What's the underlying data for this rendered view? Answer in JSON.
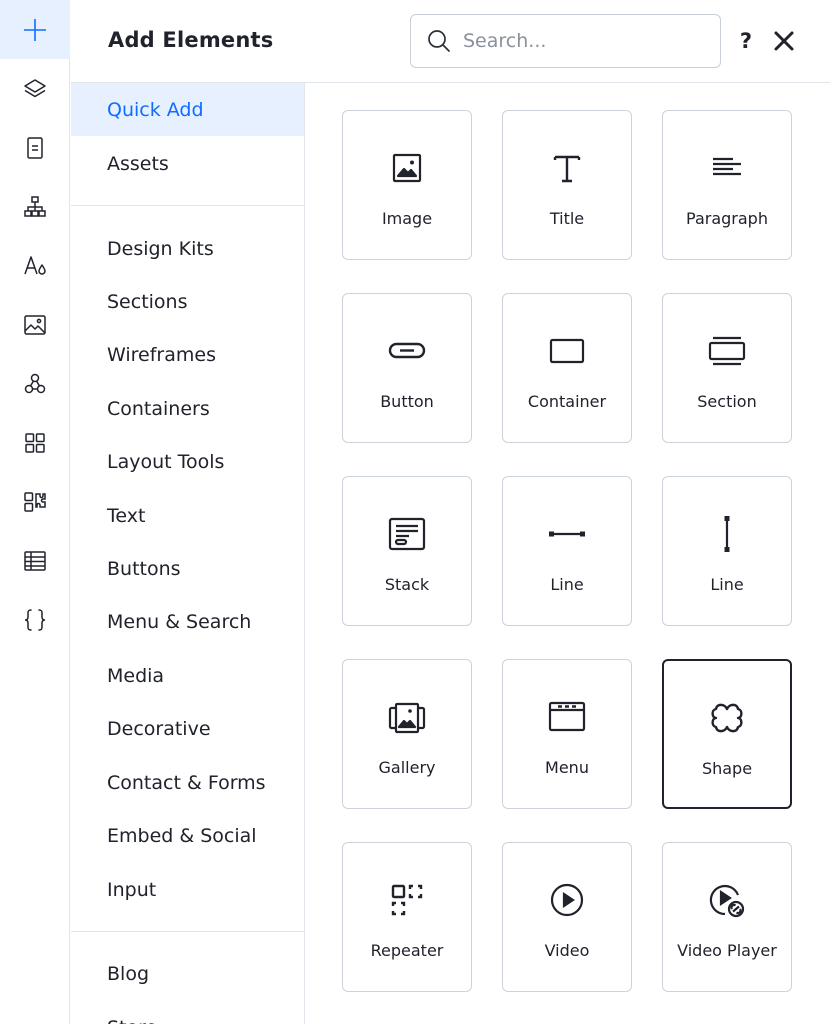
{
  "panel": {
    "title": "Add Elements",
    "search_placeholder": "Search...",
    "help_label": "?"
  },
  "rail": {
    "items": [
      {
        "icon": "plus-icon"
      },
      {
        "icon": "layers-icon"
      },
      {
        "icon": "page-icon"
      },
      {
        "icon": "sitemap-icon"
      },
      {
        "icon": "theme-icon"
      },
      {
        "icon": "media-icon"
      },
      {
        "icon": "apps-icon"
      },
      {
        "icon": "app-grid-icon"
      },
      {
        "icon": "app-market-icon"
      },
      {
        "icon": "cms-table-icon"
      },
      {
        "icon": "code-braces-icon"
      }
    ]
  },
  "categories": {
    "group1": [
      "Quick Add",
      "Assets"
    ],
    "group2": [
      "Design Kits",
      "Sections",
      "Wireframes",
      "Containers",
      "Layout Tools",
      "Text",
      "Buttons",
      "Menu & Search",
      "Media",
      "Decorative",
      "Contact & Forms",
      "Embed & Social",
      "Input"
    ],
    "group3": [
      "Blog",
      "Store"
    ]
  },
  "elements": [
    {
      "label": "Image",
      "icon": "image-icon"
    },
    {
      "label": "Title",
      "icon": "title-icon"
    },
    {
      "label": "Paragraph",
      "icon": "paragraph-icon"
    },
    {
      "label": "Button",
      "icon": "button-icon"
    },
    {
      "label": "Container",
      "icon": "container-icon"
    },
    {
      "label": "Section",
      "icon": "section-icon"
    },
    {
      "label": "Stack",
      "icon": "stack-icon"
    },
    {
      "label": "Line",
      "icon": "horizontal-line-icon"
    },
    {
      "label": "Line",
      "icon": "vertical-line-icon"
    },
    {
      "label": "Gallery",
      "icon": "gallery-icon"
    },
    {
      "label": "Menu",
      "icon": "menu-icon"
    },
    {
      "label": "Shape",
      "icon": "shape-icon"
    },
    {
      "label": "Repeater",
      "icon": "repeater-icon"
    },
    {
      "label": "Video",
      "icon": "video-icon"
    },
    {
      "label": "Video Player",
      "icon": "video-player-icon"
    }
  ],
  "colors": {
    "accent": "#116dff",
    "active_bg": "#e7f0ff",
    "text": "#20232c",
    "border": "#cdd3da"
  }
}
